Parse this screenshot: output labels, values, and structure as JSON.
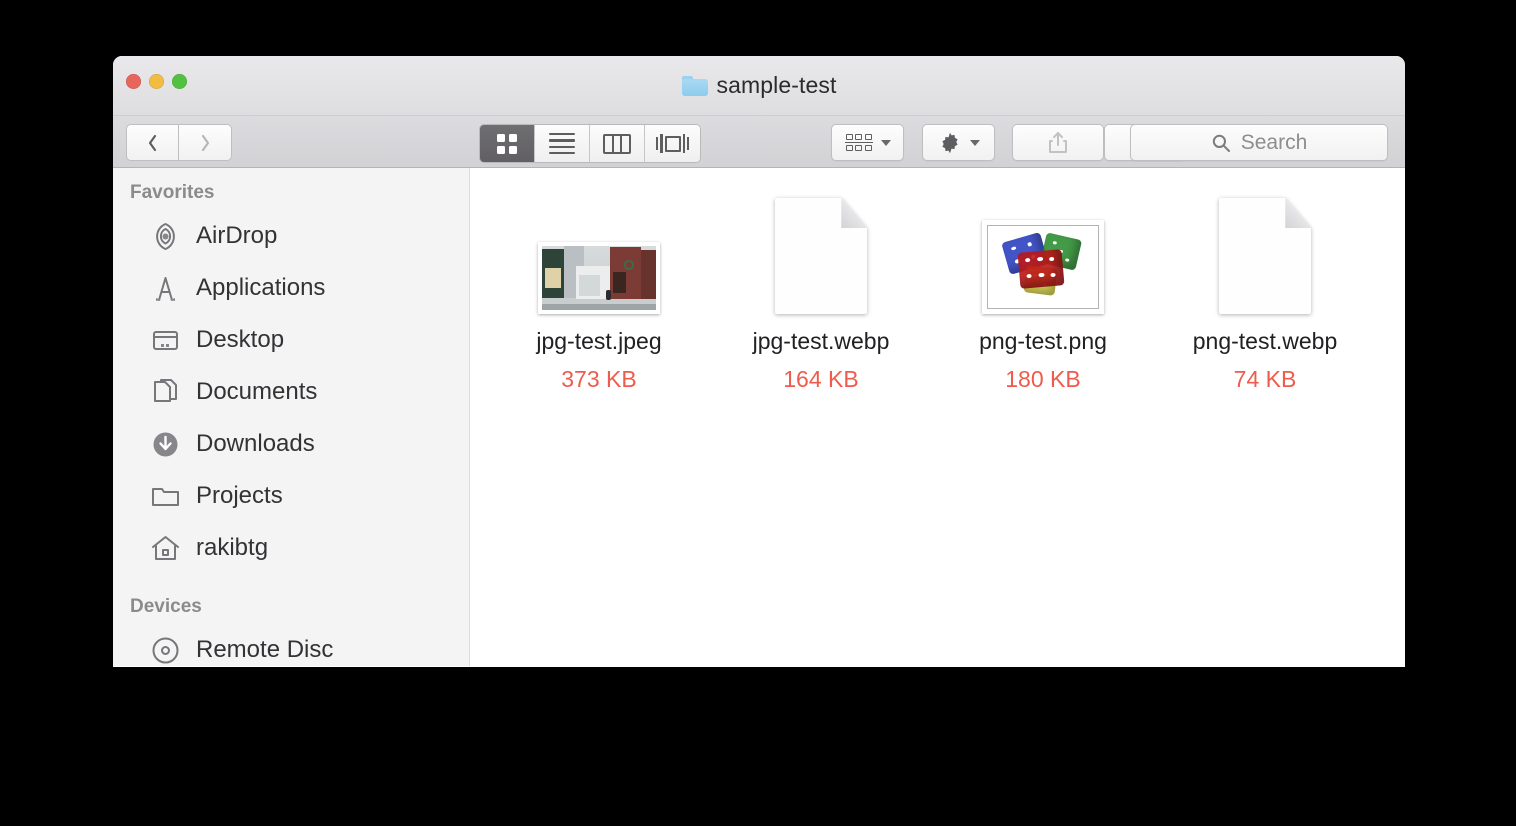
{
  "window": {
    "title": "sample-test",
    "folder_icon": "folder-icon",
    "traffic_lights": [
      {
        "name": "close-button",
        "color": "#e8655a"
      },
      {
        "name": "minimize-button",
        "color": "#f0bd42"
      },
      {
        "name": "maximize-button",
        "color": "#52c142"
      }
    ]
  },
  "toolbar": {
    "back_icon": "chevron-left-icon",
    "forward_icon": "chevron-right-icon",
    "view_modes": [
      {
        "label": "Icon view",
        "icon": "grid-view-icon",
        "selected": true
      },
      {
        "label": "List view",
        "icon": "list-view-icon",
        "selected": false
      },
      {
        "label": "Column view",
        "icon": "column-view-icon",
        "selected": false
      },
      {
        "label": "Gallery view",
        "icon": "gallery-view-icon",
        "selected": false
      }
    ],
    "arrange_icon": "arrange-group-icon",
    "action_icon": "gear-icon",
    "share_icon": "share-icon",
    "tag_icon": "tag-icon",
    "share_enabled": false,
    "tag_enabled": false
  },
  "search": {
    "placeholder": "Search",
    "value": "",
    "icon": "search-icon"
  },
  "sidebar": {
    "sections": [
      {
        "header": "Favorites",
        "items": [
          {
            "label": "AirDrop",
            "icon": "airdrop-icon"
          },
          {
            "label": "Applications",
            "icon": "applications-icon"
          },
          {
            "label": "Desktop",
            "icon": "desktop-icon"
          },
          {
            "label": "Documents",
            "icon": "documents-icon"
          },
          {
            "label": "Downloads",
            "icon": "downloads-icon"
          },
          {
            "label": "Projects",
            "icon": "folder-icon"
          },
          {
            "label": "rakibtg",
            "icon": "home-icon"
          }
        ]
      },
      {
        "header": "Devices",
        "items": [
          {
            "label": "Remote Disc",
            "icon": "disc-icon"
          }
        ]
      }
    ]
  },
  "files": {
    "size_color": "#ef5b4c",
    "items": [
      {
        "name": "jpg-test.jpeg",
        "size": "373 KB",
        "thumbnail": "photo-street-preview"
      },
      {
        "name": "jpg-test.webp",
        "size": "164 KB",
        "thumbnail": "blank-document-icon"
      },
      {
        "name": "png-test.png",
        "size": "180 KB",
        "thumbnail": "photo-dice-preview"
      },
      {
        "name": "png-test.webp",
        "size": "74 KB",
        "thumbnail": "blank-document-icon"
      }
    ]
  }
}
